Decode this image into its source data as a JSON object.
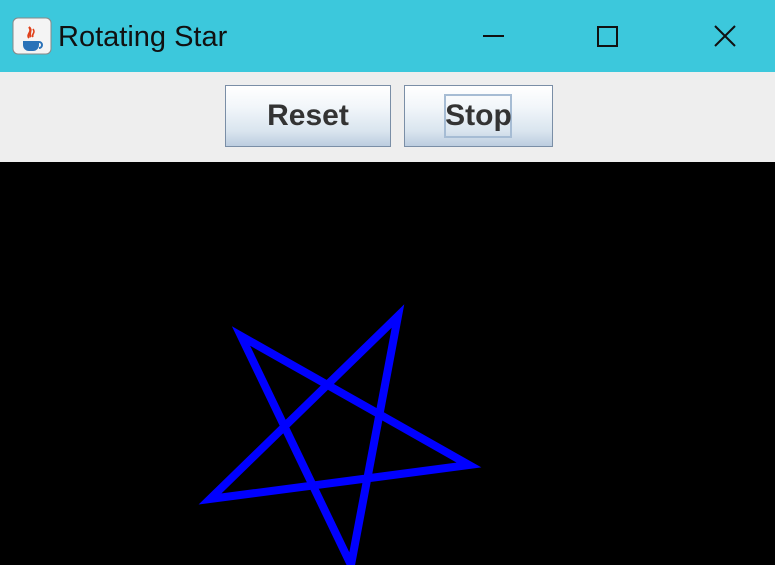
{
  "window": {
    "title": "Rotating Star",
    "icon": "java-coffee-cup-icon",
    "controls": [
      "minimize-icon",
      "maximize-icon",
      "close-icon"
    ],
    "titlebar_color": "#3cc8dc"
  },
  "toolbar": {
    "reset_label": "Reset",
    "stop_label": "Stop"
  },
  "canvas": {
    "background": "#000000",
    "shape": "five-pointed star outline",
    "star_color": "#0000ff"
  }
}
